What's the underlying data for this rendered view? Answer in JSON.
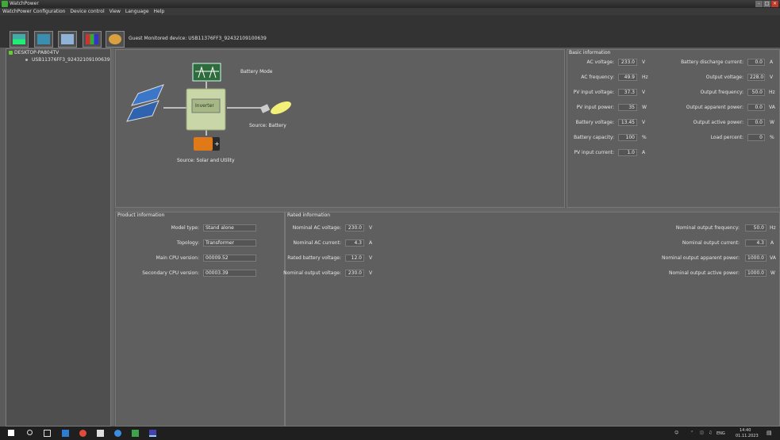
{
  "window": {
    "title": "WatchPower",
    "controls": [
      "-",
      "□",
      "×"
    ]
  },
  "menu": [
    "WatchPower Configuration",
    "Device control",
    "View",
    "Language",
    "Help"
  ],
  "toolbar": {
    "status": "Guest   Monitored device: USB11376FF3_92432109100639"
  },
  "tree": {
    "root": "DESKTOP-PA804TV",
    "child": "USB11376FF3_92432109100639"
  },
  "diagram": {
    "battery_mode": "Battery Mode",
    "inverter_label": "Inverter",
    "source_right": "Source:  Battery",
    "source_bottom": "Source:  Solar and Utility"
  },
  "basic": {
    "title": "Basic information",
    "left": [
      {
        "label": "AC voltage:",
        "value": "233.0",
        "unit": "V"
      },
      {
        "label": "AC frequency:",
        "value": "49.9",
        "unit": "Hz"
      },
      {
        "label": "PV input voltage:",
        "value": "37.3",
        "unit": "V"
      },
      {
        "label": "PV input power:",
        "value": "35",
        "unit": "W"
      },
      {
        "label": "Battery voltage:",
        "value": "13.45",
        "unit": "V"
      },
      {
        "label": "Battery capacity:",
        "value": "100",
        "unit": "%"
      },
      {
        "label": "PV input current:",
        "value": "1.0",
        "unit": "A"
      }
    ],
    "right": [
      {
        "label": "Battery discharge current:",
        "value": "0.0",
        "unit": "A"
      },
      {
        "label": "Output voltage:",
        "value": "228.0",
        "unit": "V"
      },
      {
        "label": "Output frequency:",
        "value": "50.0",
        "unit": "Hz"
      },
      {
        "label": "Output apparent power:",
        "value": "0.0",
        "unit": "VA"
      },
      {
        "label": "Output active power:",
        "value": "0.0",
        "unit": "W"
      },
      {
        "label": "Load percent:",
        "value": "0",
        "unit": "%"
      }
    ]
  },
  "product": {
    "title": "Product information",
    "rows": [
      {
        "label": "Model type:",
        "value": "Stand alone"
      },
      {
        "label": "Topology:",
        "value": "Transformer"
      },
      {
        "label": "Main CPU version:",
        "value": "00009.52"
      },
      {
        "label": "Secondary CPU version:",
        "value": "00003.39"
      }
    ]
  },
  "rated": {
    "title": "Rated information",
    "left": [
      {
        "label": "Nominal AC voltage:",
        "value": "230.0",
        "unit": "V"
      },
      {
        "label": "Nominal AC current:",
        "value": "4.3",
        "unit": "A"
      },
      {
        "label": "Rated battery voltage:",
        "value": "12.0",
        "unit": "V"
      },
      {
        "label": "Nominal output voltage:",
        "value": "230.0",
        "unit": "V"
      }
    ],
    "right": [
      {
        "label": "Nominal output frequency:",
        "value": "50.0",
        "unit": "Hz"
      },
      {
        "label": "Nominal output current:",
        "value": "4.3",
        "unit": "A"
      },
      {
        "label": "Nominal output apparent power:",
        "value": "1000.0",
        "unit": "VA"
      },
      {
        "label": "Nominal output active power:",
        "value": "1000.0",
        "unit": "W"
      }
    ]
  },
  "taskbar": {
    "lang": "ENG",
    "time": "14:40",
    "date": "01.11.2023"
  }
}
